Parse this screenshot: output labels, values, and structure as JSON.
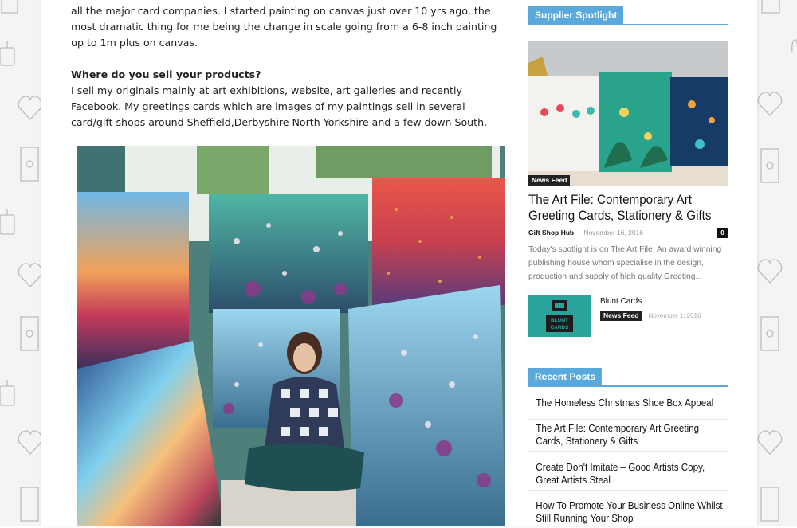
{
  "article": {
    "intro_paragraph": "all the major card companies. I started painting on canvas just over 10 yrs ago, the most dramatic thing for me being the change in scale going from a 6-8 inch painting up to 1m plus on canvas.",
    "question": "Where do you sell your products?",
    "answer_paragraph": "I sell my originals mainly at art exhibitions, website, art galleries and recently Facebook. My greetings cards which are images of my paintings sell in several card/gift shops around Sheffield,Derbyshire North Yorkshire and a few down South."
  },
  "sidebar": {
    "spotlight": {
      "heading": "Supplier Spotlight",
      "category": "News Feed",
      "title": "The Art File: Contemporary Art Greeting Cards, Stationery & Gifts",
      "author": "Gift Shop Hub",
      "date": "November 16, 2016",
      "comments": "0",
      "excerpt": "Today's spotlight is on The Art File: An award winning publishing house whom specialise in the design, production and supply of high quality Greeting...",
      "secondary": {
        "title": "Blunt Cards",
        "category": "News Feed",
        "date": "November 1, 2016",
        "thumb_text": "BLUNT CARDS"
      }
    },
    "recent": {
      "heading": "Recent Posts",
      "items": [
        "The Homeless Christmas Shoe Box Appeal",
        "The Art File: Contemporary Art Greeting Cards, Stationery & Gifts",
        "Create Don't Imitate – Good Artists Copy, Great Artists Steal",
        "How To Promote Your Business Online Whilst Still Running Your Shop"
      ]
    }
  },
  "colors": {
    "accent": "#5aa9dc",
    "badge": "#222222"
  }
}
